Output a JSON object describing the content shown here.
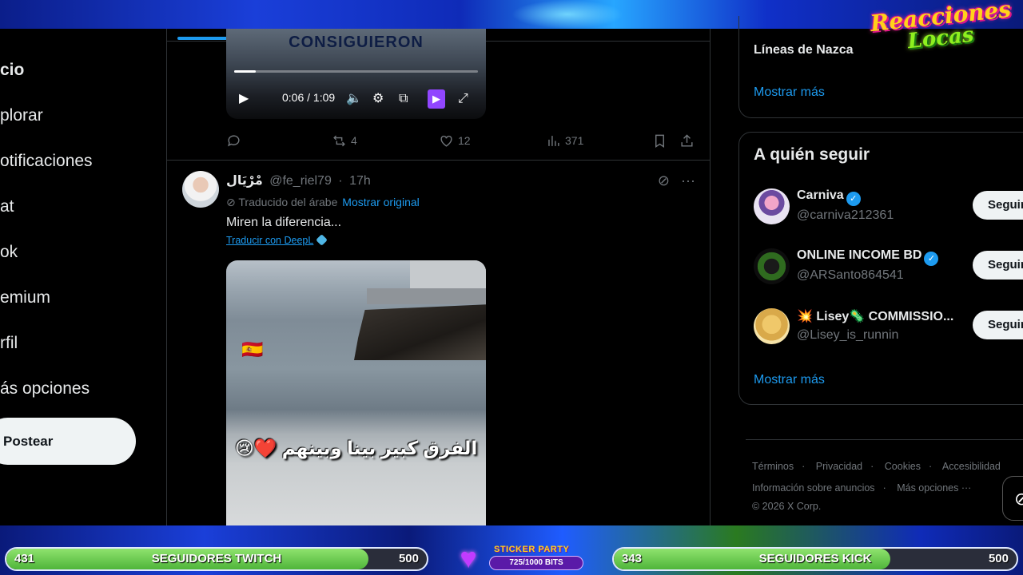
{
  "overlay": {
    "logo_line1": "Reacciones",
    "logo_line2": "Locas",
    "twitch_bar": {
      "current": "431",
      "label": "SEGUIDORES TWITCH",
      "goal": "500",
      "progress": 0.862
    },
    "kick_bar": {
      "current": "343",
      "label": "SEGUIDORES KICK",
      "goal": "500",
      "progress": 0.686
    },
    "sticker_party": {
      "title": "STICKER PARTY",
      "progress_text": "725/1000 BITS",
      "progress": 0.725
    }
  },
  "nav": {
    "items": [
      {
        "label": "cio",
        "active": true
      },
      {
        "label": "plorar"
      },
      {
        "label": "otificaciones"
      },
      {
        "label": "at"
      },
      {
        "label": "ok"
      },
      {
        "label": "emium"
      },
      {
        "label": "rfil"
      },
      {
        "label": "ás opciones"
      }
    ],
    "post_label": "Postear"
  },
  "video_tweet": {
    "overlay_title": "CONSIGUIERON",
    "time": "0:06 / 1:09",
    "progress": 0.09,
    "actions": {
      "reposts": "4",
      "likes": "12",
      "views": "371"
    }
  },
  "tweet": {
    "display_name": "مْرْيَال",
    "handle": "@fe_riel79",
    "time": "17h",
    "translated_label": "Traducido del árabe",
    "show_original": "Mostrar original",
    "text": "Miren la diferencia...",
    "deepl_link": "Traducir con DeepL",
    "media_caption": "الفرق كبير بينا وبينهم ❤️😢"
  },
  "right": {
    "trend": "Líneas de Nazca",
    "show_more_1": "Mostrar más",
    "who_to_follow": "A quién seguir",
    "suggestions": [
      {
        "name": "Carniva",
        "handle": "@carniva212361",
        "verified": true,
        "button": "Seguir"
      },
      {
        "name": "ONLINE INCOME BD",
        "handle": "@ARSanto864541",
        "verified": true,
        "button": "Seguir"
      },
      {
        "name": "💥 Lisey🦠 COMMISSIO...",
        "handle": "@Lisey_is_runnin",
        "verified": false,
        "button": "Seguir"
      }
    ],
    "show_more_2": "Mostrar más",
    "footer_row1": [
      "Términos",
      "Privacidad",
      "Cookies",
      "Accesibilidad"
    ],
    "footer_row2": [
      "Información sobre anuncios",
      "Más opciones ···"
    ],
    "copyright": "© 2026 X Corp."
  },
  "colors": {
    "accent": "#1d9bf0",
    "text": "#e7e9ea",
    "muted": "#71767b",
    "border": "#2f3336"
  }
}
